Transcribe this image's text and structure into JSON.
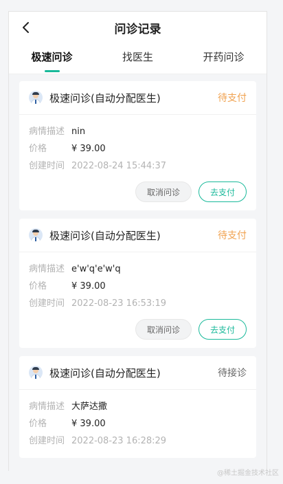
{
  "header": {
    "title": "问诊记录",
    "back_icon": "chevron-left-icon"
  },
  "tabs": [
    {
      "label": "极速问诊",
      "active": true
    },
    {
      "label": "找医生",
      "active": false
    },
    {
      "label": "开药问诊",
      "active": false
    }
  ],
  "labels": {
    "desc": "病情描述",
    "price": "价格",
    "created": "创建时间"
  },
  "colors": {
    "accent": "#19b99a",
    "pending_pay": "#f0a250",
    "pending_accept": "#666666"
  },
  "orders": [
    {
      "title": "极速问诊(自动分配医生)",
      "status": "待支付",
      "status_type": "pending_pay",
      "desc": "nin",
      "price": "¥ 39.00",
      "created": "2022-08-24 15:44:37",
      "cancel_label": "取消问诊",
      "pay_label": "去支付"
    },
    {
      "title": "极速问诊(自动分配医生)",
      "status": "待支付",
      "status_type": "pending_pay",
      "desc": "e'w'q'e'w'q",
      "price": "¥ 39.00",
      "created": "2022-08-23 16:53:19",
      "cancel_label": "取消问诊",
      "pay_label": "去支付"
    },
    {
      "title": "极速问诊(自动分配医生)",
      "status": "待接诊",
      "status_type": "pending_accept",
      "desc": "大萨达撒",
      "price": "¥ 39.00",
      "created": "2022-08-23 16:28:29"
    }
  ],
  "watermark": "@稀土掘金技术社区"
}
